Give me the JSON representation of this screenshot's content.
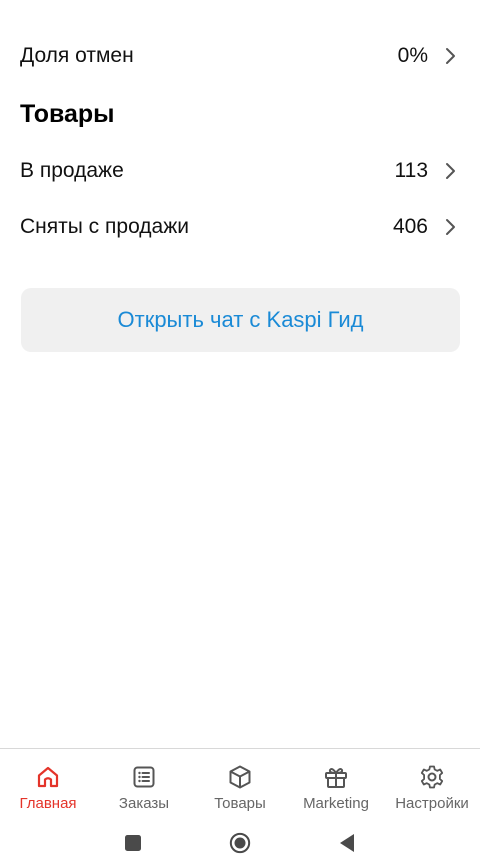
{
  "stats": {
    "clipped_label": "...",
    "cancel_rate": {
      "label": "Доля отмен",
      "value": "0%"
    }
  },
  "products": {
    "title": "Товары",
    "on_sale": {
      "label": "В продаже",
      "value": "113"
    },
    "removed": {
      "label": "Сняты с продажи",
      "value": "406"
    }
  },
  "chat_button": {
    "label": "Открыть чат с Kaspi Гид"
  },
  "tabbar": {
    "tabs": [
      {
        "label": "Главная",
        "icon": "home-icon",
        "active": true
      },
      {
        "label": "Заказы",
        "icon": "list-icon",
        "active": false
      },
      {
        "label": "Товары",
        "icon": "box-icon",
        "active": false
      },
      {
        "label": "Marketing",
        "icon": "gift-icon",
        "active": false
      },
      {
        "label": "Настройки",
        "icon": "gear-icon",
        "active": false
      }
    ]
  },
  "colors": {
    "accent_red": "#e4342a",
    "link_blue": "#1a8ad6",
    "button_bg": "#f0f0f0"
  },
  "system_nav": {
    "icons": [
      "recents-square-icon",
      "home-circle-icon",
      "back-triangle-icon"
    ]
  }
}
